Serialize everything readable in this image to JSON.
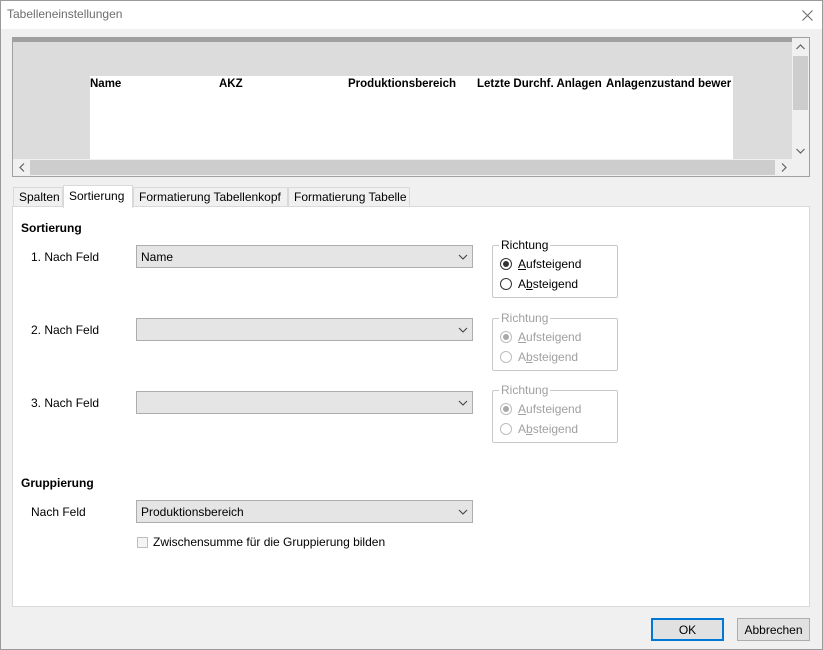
{
  "window": {
    "title": "Tabelleneinstellungen"
  },
  "preview": {
    "columns": [
      "Name",
      "AKZ",
      "Produktionsbereich",
      "Letzte Durchf. Anlagen",
      "Anlagenzustand bewer"
    ]
  },
  "tabs": [
    "Spalten",
    "Sortierung",
    "Formatierung Tabellenkopf",
    "Formatierung Tabelle"
  ],
  "sorting": {
    "title": "Sortierung",
    "fields": [
      {
        "label": "1. Nach Feld",
        "value": "Name",
        "direction_legend": "Richtung",
        "asc": "Aufsteigend",
        "desc": "Absteigend",
        "enabled": true
      },
      {
        "label": "2. Nach Feld",
        "value": "",
        "direction_legend": "Richtung",
        "asc": "Aufsteigend",
        "desc": "Absteigend",
        "enabled": false
      },
      {
        "label": "3. Nach Feld",
        "value": "",
        "direction_legend": "Richtung",
        "asc": "Aufsteigend",
        "desc": "Absteigend",
        "enabled": false
      }
    ]
  },
  "grouping": {
    "title": "Gruppierung",
    "field_label": "Nach Feld",
    "field_value": "Produktionsbereich",
    "subtotal_label": "Zwischensumme für die Gruppierung bilden"
  },
  "buttons": {
    "ok": "OK",
    "cancel": "Abbrechen"
  }
}
